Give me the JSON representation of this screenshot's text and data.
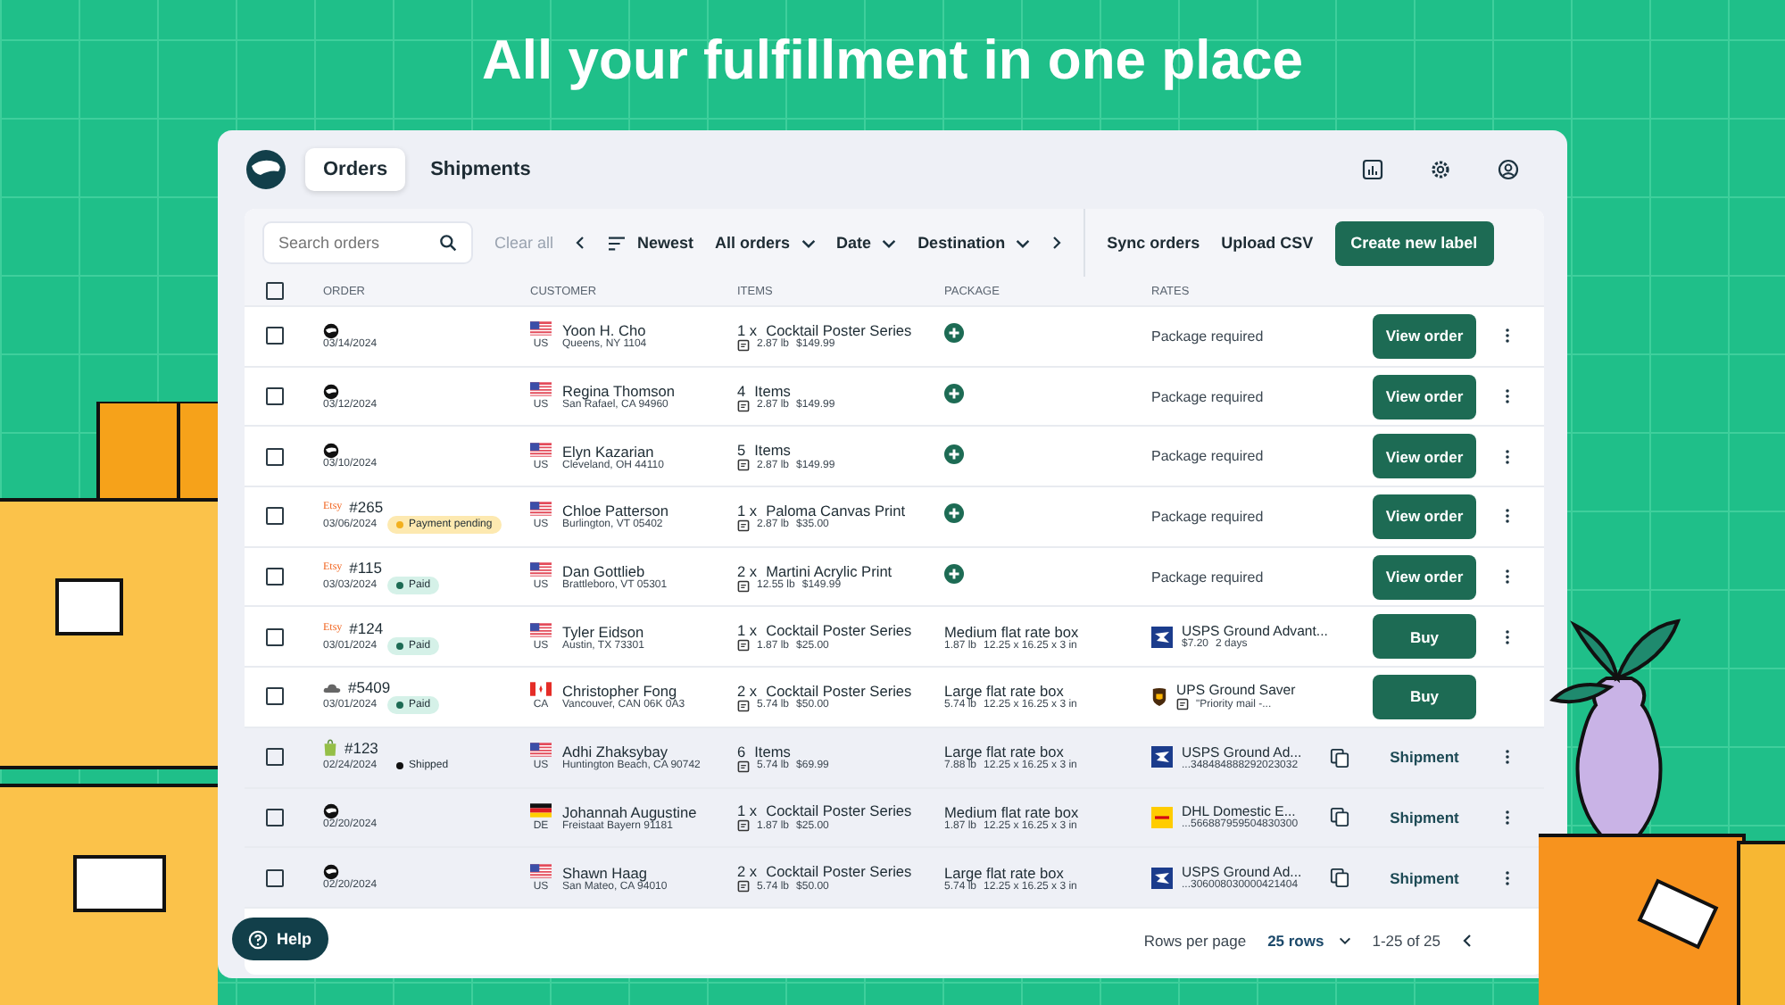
{
  "headline": "All your fulfillment in one place",
  "tabs": [
    {
      "label": "Orders",
      "selected": true
    },
    {
      "label": "Shipments",
      "selected": false
    }
  ],
  "toolbar": {
    "search": {
      "placeholder": "Search orders"
    },
    "clear": "Clear all",
    "sort": "Newest",
    "filters": [
      "All orders",
      "Date",
      "Destination"
    ],
    "actions": [
      "Sync orders",
      "Upload CSV"
    ],
    "primary": "Create new label"
  },
  "columns": [
    "ORDER",
    "CUSTOMER",
    "ITEMS",
    "PACKAGE",
    "RATES"
  ],
  "header_checked": false,
  "rows": [
    {
      "checked": false,
      "fulfilled": false,
      "menu": true,
      "source": {
        "kind": "logo"
      },
      "date": "03/14/2024",
      "country": {
        "kind": "us",
        "code": "US"
      },
      "name": "Yoon H. Cho",
      "address": "Queens, NY 1104",
      "items": {
        "qty": "1 x",
        "title": "Cocktail Poster Series",
        "weight": "2.87 lb",
        "price": "$149.99"
      },
      "package": {
        "kind": "add"
      },
      "rate": {
        "kind": "required",
        "text": "Package required"
      },
      "action": {
        "kind": "view",
        "label": "View order"
      }
    },
    {
      "checked": false,
      "fulfilled": false,
      "menu": true,
      "source": {
        "kind": "logo"
      },
      "date": "03/12/2024",
      "country": {
        "kind": "us",
        "code": "US"
      },
      "name": "Regina Thomson",
      "address": "San Rafael, CA 94960",
      "items": {
        "qty": "4",
        "title": "Items",
        "weight": "2.87 lb",
        "price": "$149.99"
      },
      "package": {
        "kind": "add"
      },
      "rate": {
        "kind": "required",
        "text": "Package required"
      },
      "action": {
        "kind": "view",
        "label": "View order"
      }
    },
    {
      "checked": false,
      "fulfilled": false,
      "menu": true,
      "source": {
        "kind": "logo"
      },
      "date": "03/10/2024",
      "country": {
        "kind": "us",
        "code": "US"
      },
      "name": "Elyn Kazarian",
      "address": "Cleveland, OH 44110",
      "items": {
        "qty": "5",
        "title": "Items",
        "weight": "2.87 lb",
        "price": "$149.99"
      },
      "package": {
        "kind": "add"
      },
      "rate": {
        "kind": "required",
        "text": "Package required"
      },
      "action": {
        "kind": "view",
        "label": "View order"
      }
    },
    {
      "checked": false,
      "fulfilled": false,
      "menu": true,
      "source": {
        "kind": "etsy",
        "label": "Etsy"
      },
      "number": "#265",
      "date": "03/06/2024",
      "status": {
        "kind": "pending",
        "label": "Payment pending"
      },
      "country": {
        "kind": "us",
        "code": "US"
      },
      "name": "Chloe Patterson",
      "address": "Burlington, VT 05402",
      "items": {
        "qty": "1 x",
        "title": "Paloma Canvas Print",
        "weight": "2.87 lb",
        "price": "$35.00"
      },
      "package": {
        "kind": "add"
      },
      "rate": {
        "kind": "required",
        "text": "Package required"
      },
      "action": {
        "kind": "view",
        "label": "View order"
      }
    },
    {
      "checked": false,
      "fulfilled": false,
      "menu": true,
      "source": {
        "kind": "etsy",
        "label": "Etsy"
      },
      "number": "#115",
      "date": "03/03/2024",
      "status": {
        "kind": "paid",
        "label": "Paid"
      },
      "country": {
        "kind": "us",
        "code": "US"
      },
      "name": "Dan Gottlieb",
      "address": "Brattleboro, VT 05301",
      "items": {
        "qty": "2 x",
        "title": "Martini Acrylic Print",
        "weight": "12.55 lb",
        "price": "$149.99"
      },
      "package": {
        "kind": "add"
      },
      "rate": {
        "kind": "required",
        "text": "Package required"
      },
      "action": {
        "kind": "view",
        "label": "View order"
      }
    },
    {
      "checked": false,
      "fulfilled": false,
      "menu": true,
      "source": {
        "kind": "etsy",
        "label": "Etsy"
      },
      "number": "#124",
      "date": "03/01/2024",
      "status": {
        "kind": "paid",
        "label": "Paid"
      },
      "country": {
        "kind": "us",
        "code": "US"
      },
      "name": "Tyler Eidson",
      "address": "Austin, TX 73301",
      "items": {
        "qty": "1 x",
        "title": "Cocktail Poster Series",
        "weight": "1.87 lb",
        "price": "$25.00"
      },
      "package": {
        "kind": "box",
        "name": "Medium flat rate box",
        "weight": "1.87 lb",
        "size": "12.25 x 16.25 x 3 in"
      },
      "rate": {
        "kind": "quote",
        "logo": {
          "kind": "usps"
        },
        "service": "USPS Ground Advant...",
        "price": "$7.20",
        "days": "2 days"
      },
      "action": {
        "kind": "buy",
        "label": "Buy"
      }
    },
    {
      "checked": false,
      "fulfilled": false,
      "menu": false,
      "source": {
        "kind": "cloud"
      },
      "number": "#5409",
      "date": "03/01/2024",
      "status": {
        "kind": "paid",
        "label": "Paid"
      },
      "country": {
        "kind": "ca",
        "code": "CA"
      },
      "name": "Christopher Fong",
      "address": "Vancouver, CAN 06K 0A3",
      "items": {
        "qty": "2 x",
        "title": "Cocktail Poster Series",
        "weight": "5.74 lb",
        "price": "$50.00"
      },
      "package": {
        "kind": "box",
        "name": "Large flat rate box",
        "weight": "5.74 lb",
        "size": "12.25 x 16.25 x 3 in"
      },
      "rate": {
        "kind": "note",
        "logo": {
          "kind": "ups"
        },
        "service": "UPS Ground Saver",
        "note": "\"Priority mail -..."
      },
      "action": {
        "kind": "buy",
        "label": "Buy"
      }
    },
    {
      "checked": false,
      "fulfilled": true,
      "menu": true,
      "source": {
        "kind": "bag"
      },
      "number": "#123",
      "date": "02/24/2024",
      "status": {
        "kind": "shipped",
        "label": "Shipped"
      },
      "country": {
        "kind": "us",
        "code": "US"
      },
      "name": "Adhi Zhaksybay",
      "address": "Huntington Beach, CA 90742",
      "items": {
        "qty": "6",
        "title": "Items",
        "weight": "5.74 lb",
        "price": "$69.99"
      },
      "package": {
        "kind": "box",
        "name": "Large flat rate box",
        "weight": "7.88 lb",
        "size": "12.25 x 16.25 x 3 in"
      },
      "rate": {
        "kind": "tracking",
        "logo": {
          "kind": "usps"
        },
        "service": "USPS Ground Ad...",
        "tracking": "...348484888292023032"
      },
      "action": {
        "kind": "shipment",
        "label": "Shipment"
      }
    },
    {
      "checked": false,
      "fulfilled": true,
      "menu": true,
      "source": {
        "kind": "logo"
      },
      "date": "02/20/2024",
      "country": {
        "kind": "de",
        "code": "DE"
      },
      "name": "Johannah Augustine",
      "address": "Freistaat Bayern 91181",
      "items": {
        "qty": "1 x",
        "title": "Cocktail Poster Series",
        "weight": "1.87 lb",
        "price": "$25.00"
      },
      "package": {
        "kind": "box",
        "name": "Medium flat rate box",
        "weight": "1.87 lb",
        "size": "12.25 x 16.25 x 3 in"
      },
      "rate": {
        "kind": "tracking",
        "logo": {
          "kind": "dhl"
        },
        "service": "DHL Domestic E...",
        "tracking": "...566887959504830300"
      },
      "action": {
        "kind": "shipment",
        "label": "Shipment"
      }
    },
    {
      "checked": false,
      "fulfilled": true,
      "menu": true,
      "source": {
        "kind": "logo"
      },
      "date": "02/20/2024",
      "country": {
        "kind": "us",
        "code": "US"
      },
      "name": "Shawn Haag",
      "address": "San Mateo, CA 94010",
      "items": {
        "qty": "2 x",
        "title": "Cocktail Poster Series",
        "weight": "5.74 lb",
        "price": "$50.00"
      },
      "package": {
        "kind": "box",
        "name": "Large flat rate box",
        "weight": "5.74 lb",
        "size": "12.25 x 16.25 x 3 in"
      },
      "rate": {
        "kind": "tracking",
        "logo": {
          "kind": "usps"
        },
        "service": "USPS Ground Ad...",
        "tracking": "...306008030000421404"
      },
      "action": {
        "kind": "shipment",
        "label": "Shipment"
      }
    }
  ],
  "footer": {
    "rows_label": "Rows per page",
    "rows_value": "25 rows",
    "range": "1-25 of 25"
  },
  "help": "Help"
}
